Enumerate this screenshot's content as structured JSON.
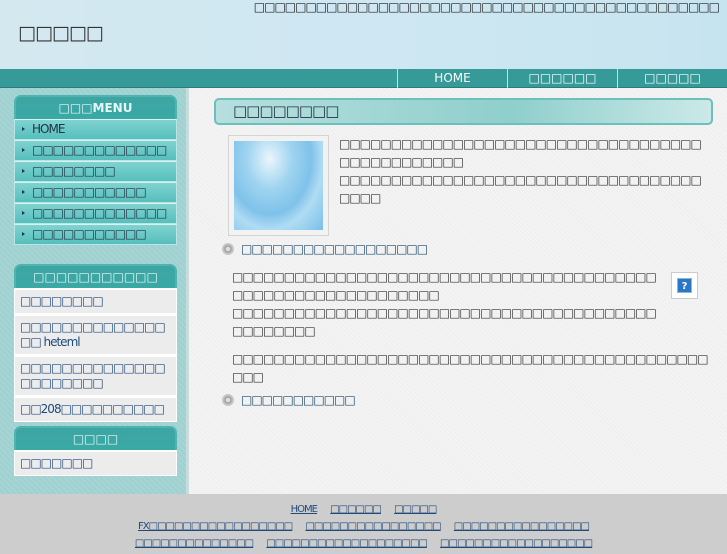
{
  "header": {
    "tagline": "□□□□□□□□□□□□□□□□□□□□□□□□□□□□□□□□□□□□□□□□□□□□□",
    "site_title": "□□□□□"
  },
  "nav": [
    "HOME",
    "□□□□□□",
    "□□□□□"
  ],
  "menu": {
    "title": "□□□MENU",
    "items": [
      "HOME",
      "□□□□□□□□□□□□□",
      "□□□□□□□□",
      "□□□□□□□□□□□",
      "□□□□□□□□□□□□□",
      "□□□□□□□□□□□"
    ]
  },
  "links_box": {
    "title": "□□□□□□□□□□□",
    "items": [
      "□□□□□□□□",
      "□□□□□□□□□□□□□□□□ heteml",
      "□□□□□□□□□□□□□□□□□□□□□□",
      "□□208□□□□□□□□□□"
    ]
  },
  "box3": {
    "title": "□□□□",
    "items": [
      "□□□□□□□"
    ]
  },
  "content": {
    "heading": "□□□□□□□□",
    "intro": [
      "□□□□□□□□□□□□□□□□□□□□□□□□□□□□□□□□□□□□□□□□□□□□□□□",
      "□□□□□□□□□□□□□□□□□□□□□□□□□□□□□□□□□□□□□□□"
    ],
    "bullet1": "□□□□□□□□□□□□□□□□□□",
    "para1": [
      "□□□□□□□□□□□□□□□□□□□□□□□□□□□□□□□□□□□□□□□□□□□□□□□□□□□□□□□□□□□□□",
      "□□□□□□□□□□□□□□□□□□□□□□□□□□□□□□□□□□□□□□□□□□□□□□□□□"
    ],
    "para2": "□□□□□□□□□□□□□□□□□□□□□□□□□□□□□□□□□□□□□□□□□□□□□□□□□",
    "bullet2": "□□□□□□□□□□□",
    "help_label": "?"
  },
  "footer": {
    "row1": [
      "HOME",
      "□□□□□□",
      "□□□□□"
    ],
    "row2": [
      "FX□□□□□□□□□□□□□□□□□",
      "□□□□□□□□□□□□□□□□",
      "□□□□□□□□□□□□□□□□"
    ],
    "row3": [
      "□□□□□□□□□□□□□□",
      "□□□□□□□□□□□□□□□□□□□",
      "□□□□□□□□□□□□□□□□□□"
    ]
  }
}
